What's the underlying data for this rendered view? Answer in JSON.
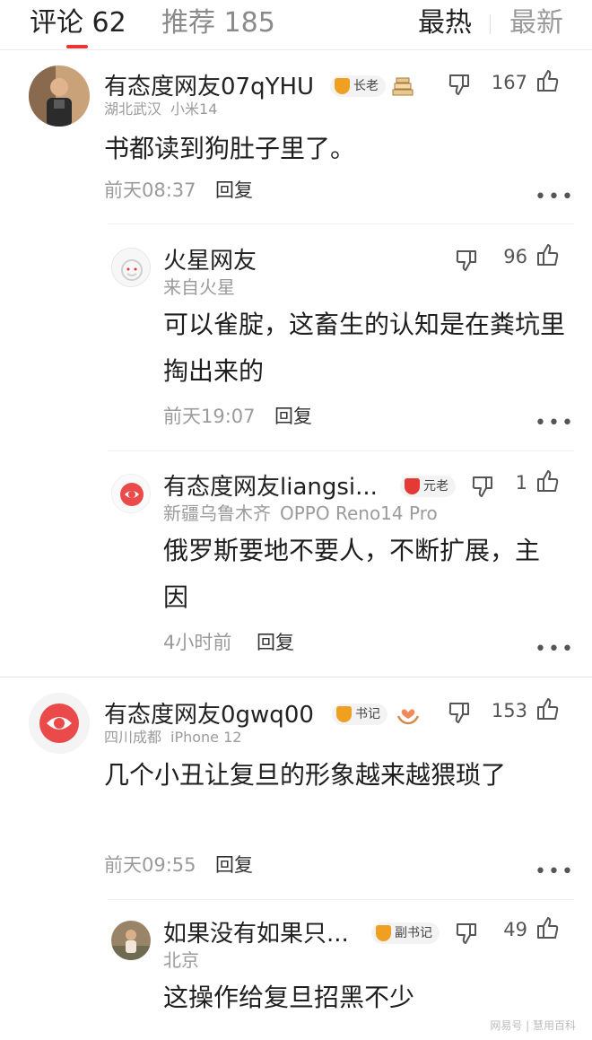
{
  "header": {
    "tab_comments": "评论 62",
    "tab_recommend": "推荐 185",
    "sort_hot": "最热",
    "sort_new": "最新"
  },
  "colors": {
    "accent": "#e33333",
    "badge_gold": "#f0a020",
    "badge_red": "#e53935"
  },
  "comments": [
    {
      "user": "有态度网友07qYHU",
      "badge": "长老",
      "location": "湖北武汉",
      "device": "小米14",
      "text": "书都读到狗肚子里了。",
      "time": "前天08:37",
      "reply": "回复",
      "likes": "167",
      "icons": [
        "dislike-icon",
        "like-icon",
        "books-icon",
        "more-icon"
      ]
    },
    {
      "user": "火星网友",
      "location": "来自火星",
      "text": "可以雀腚，这畜生的认知是在粪坑里掏出来的",
      "time": "前天19:07",
      "reply": "回复",
      "likes": "96"
    },
    {
      "user": "有态度网友liangsi...",
      "badge": "元老",
      "location": "新疆乌鲁木齐",
      "device": "OPPO Reno14 Pro",
      "text": "俄罗斯要地不要人，不断扩展，主因",
      "time": "4小时前",
      "reply": "回复",
      "likes": "1"
    },
    {
      "user": "有态度网友0gwq00",
      "badge": "书记",
      "location": "四川成都",
      "device": "iPhone 12",
      "text": "几个小丑让复旦的形象越来越猥琐了",
      "time": "前天09:55",
      "reply": "回复",
      "likes": "153"
    },
    {
      "user": "如果没有如果只...",
      "badge": "副书记",
      "location": "北京",
      "text": "这操作给复旦招黑不少",
      "likes": "49"
    }
  ],
  "more_label": "•••",
  "watermark": "网易号 | 慧用百科"
}
